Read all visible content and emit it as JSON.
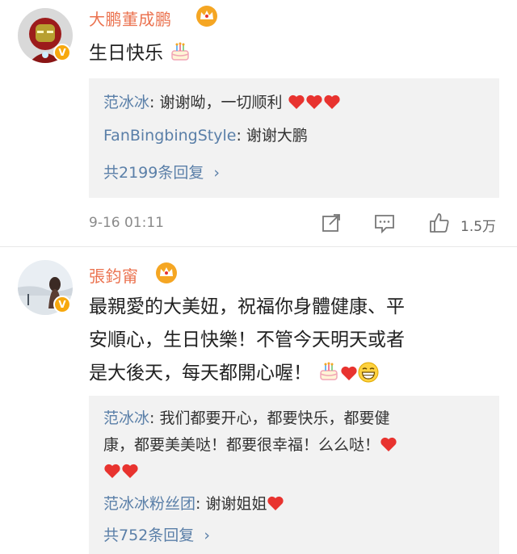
{
  "comments": [
    {
      "username": "大鹏董成鹏",
      "text": "生日快乐",
      "replies": [
        {
          "name": "范冰冰",
          "text": ": 谢谢呦，一切顺利"
        },
        {
          "name": "FanBingbingStyle",
          "text": ": 谢谢大鹏"
        }
      ],
      "more_replies": "共2199条回复",
      "more_arrow": "›",
      "timestamp": "9-16 01:11",
      "likes": "1.5万"
    },
    {
      "username": "張鈞甯",
      "text_line1": "最親愛的大美妞，祝福你身體健康、平",
      "text_line2": "安順心，生日快樂！不管今天明天或者",
      "text_line3": "是大後天，每天都開心喔！",
      "replies": [
        {
          "name": "范冰冰",
          "text_line1": ": 我们都要开心，都要快乐，都要健",
          "text_line2": "康，都要美美哒！都要很幸福！么么哒！"
        },
        {
          "name": "范冰冰粉丝团",
          "text": ": 谢谢姐姐"
        }
      ],
      "more_replies": "共752条回复",
      "more_arrow": "›"
    }
  ],
  "colors": {
    "username": "#eb7350",
    "reply_name": "#5a7fa8",
    "reply_bg": "#f2f2f2",
    "heart": "#e8332f",
    "crown": "#f5a623",
    "verified_badge": "#f7a80d"
  },
  "icons": {
    "crown": "crown-icon",
    "verified": "verified-badge-icon",
    "cake": "birthday-cake-emoji",
    "heart": "red-heart-emoji",
    "grin": "grinning-emoji",
    "share": "share-icon",
    "comment": "comment-icon",
    "like": "thumbs-up-icon"
  }
}
